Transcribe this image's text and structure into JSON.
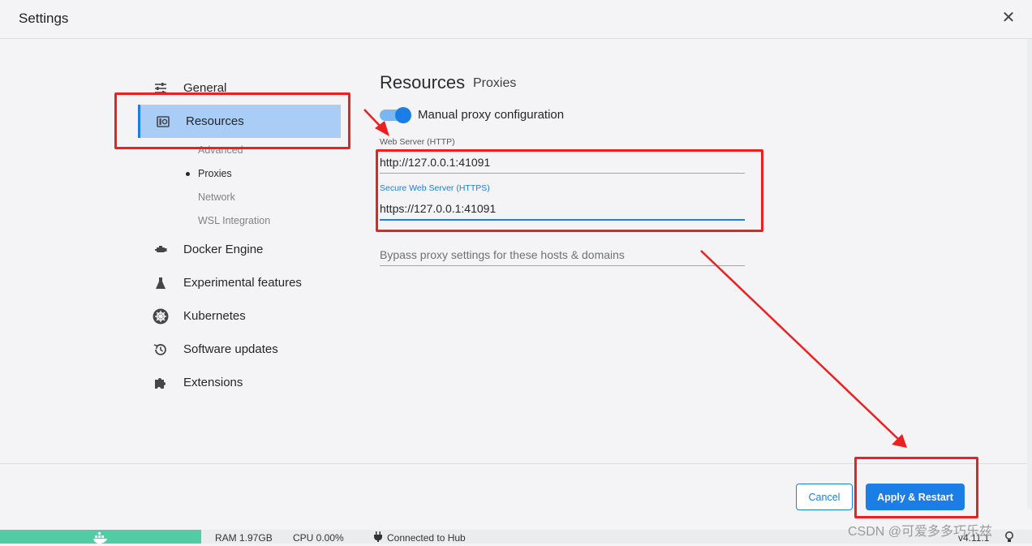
{
  "window": {
    "title": "Settings"
  },
  "sidebar": {
    "items": [
      {
        "label": "General",
        "icon": "sliders-icon"
      },
      {
        "label": "Resources",
        "icon": "resources-icon",
        "active": true
      },
      {
        "label": "Docker Engine",
        "icon": "engine-icon"
      },
      {
        "label": "Experimental features",
        "icon": "flask-icon"
      },
      {
        "label": "Kubernetes",
        "icon": "helm-icon"
      },
      {
        "label": "Software updates",
        "icon": "history-icon"
      },
      {
        "label": "Extensions",
        "icon": "puzzle-icon"
      }
    ],
    "sub_items": [
      {
        "label": "Advanced"
      },
      {
        "label": "Proxies",
        "active": true
      },
      {
        "label": "Network"
      },
      {
        "label": "WSL Integration"
      }
    ]
  },
  "main": {
    "heading": "Resources",
    "subheading": "Proxies",
    "toggle_label": "Manual proxy configuration",
    "toggle_on": true,
    "http_label": "Web Server (HTTP)",
    "http_value": "http://127.0.0.1:41091",
    "https_label": "Secure Web Server (HTTPS)",
    "https_value": "https://127.0.0.1:41091",
    "bypass_placeholder": "Bypass proxy settings for these hosts & domains"
  },
  "footer": {
    "cancel_label": "Cancel",
    "apply_label": "Apply & Restart"
  },
  "statusbar": {
    "ram": "RAM 1.97GB",
    "cpu": "CPU 0.00%",
    "hub": "Connected to Hub",
    "version": "v4.11.1"
  },
  "watermark": "CSDN @可爱多多巧乐兹",
  "colors": {
    "accent": "#1b7ee6",
    "selection": "#a9cdf5",
    "annotation": "#ec2020",
    "whale": "#52cca4"
  }
}
